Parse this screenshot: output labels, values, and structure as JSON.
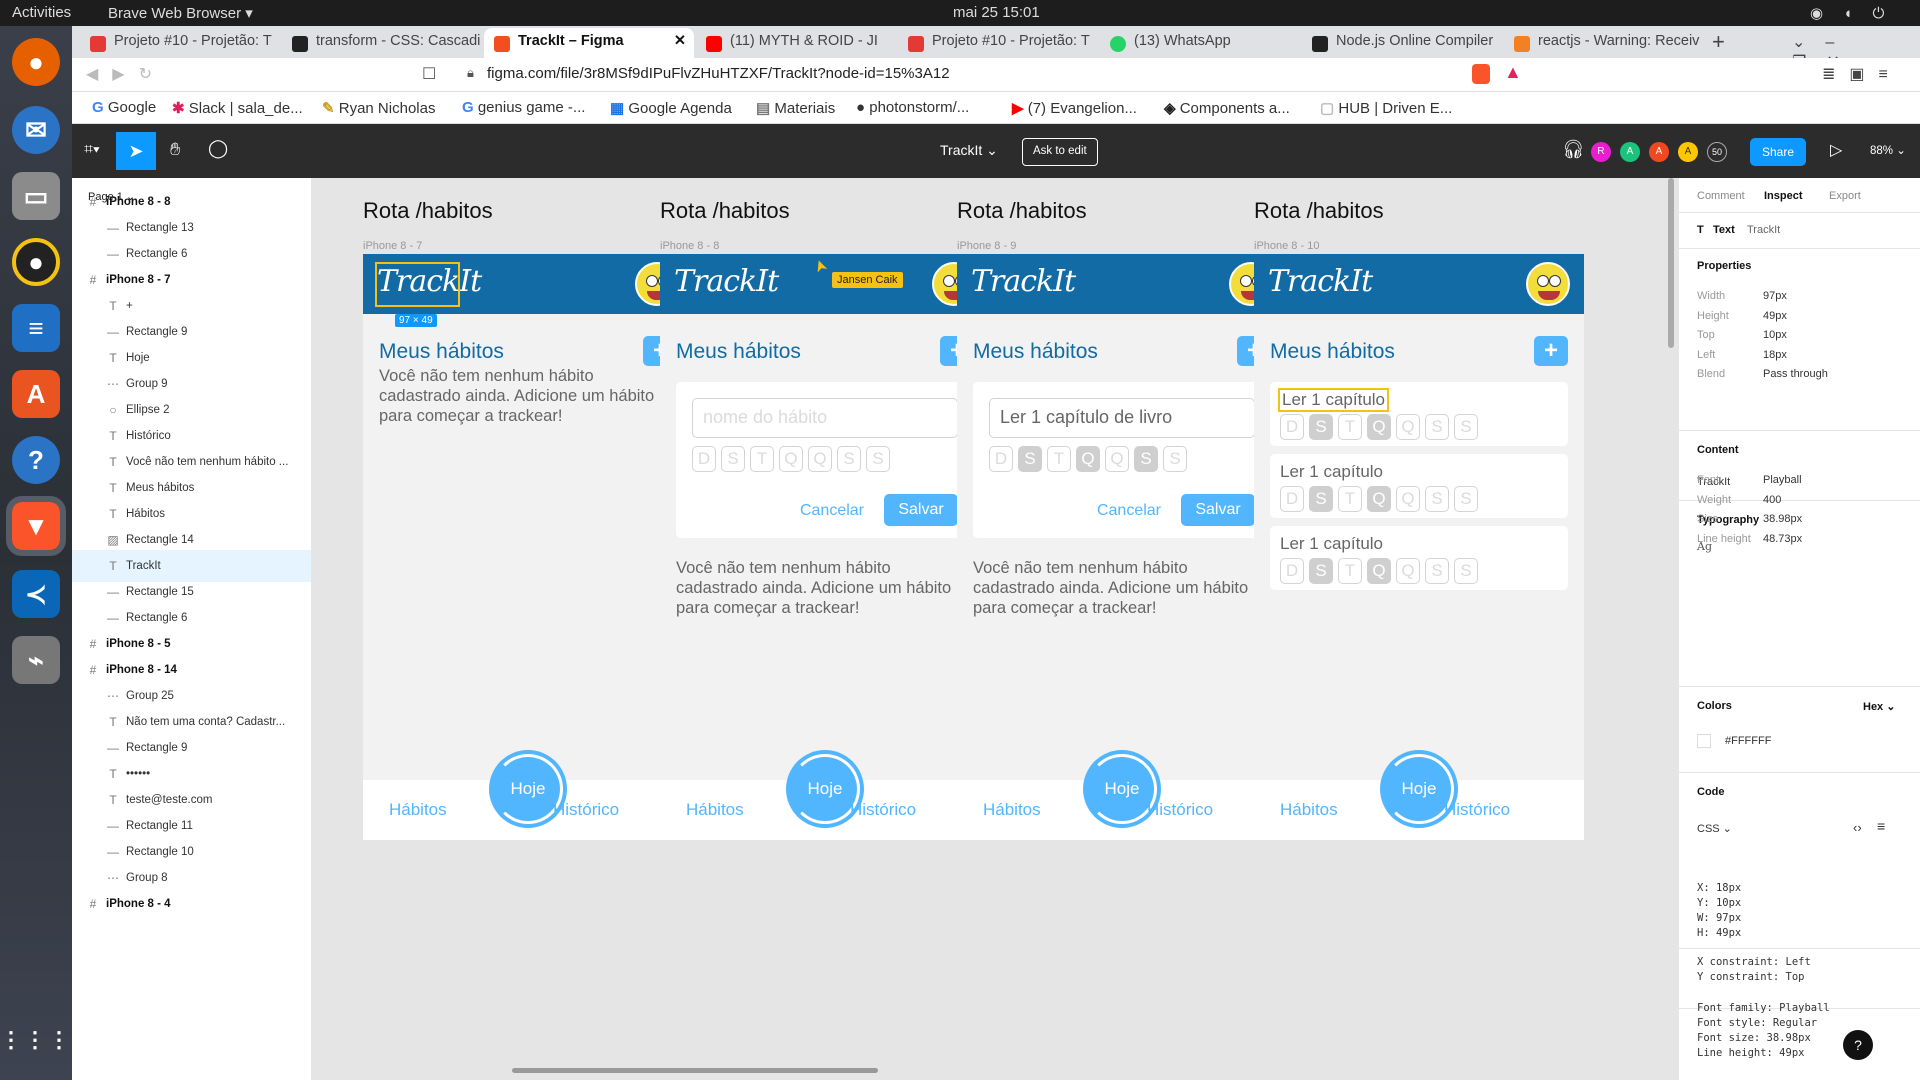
{
  "os": {
    "activities": "Activities",
    "browser": "Brave Web Browser",
    "clock": "mai 25  15:01"
  },
  "tabs": [
    {
      "label": "Projeto #10 - Projetão: T",
      "color": "#e53935"
    },
    {
      "label": "transform - CSS: Cascadi",
      "color": "#222222"
    },
    {
      "label": "TrackIt – Figma",
      "color": "#f24e1e",
      "active": true
    },
    {
      "label": "(11) MYTH & ROID - JI",
      "color": "#ff0000"
    },
    {
      "label": "Projeto #10 - Projetão: T",
      "color": "#e53935"
    },
    {
      "label": "(13) WhatsApp",
      "color": "#25d366"
    },
    {
      "label": "Node.js Online Compiler",
      "color": "#222222"
    },
    {
      "label": "reactjs - Warning: Receiv",
      "color": "#f48024"
    }
  ],
  "url": "figma.com/file/3r8MSf9dIPuFlvZHuHTZXF/TrackIt?node-id=15%3A12",
  "bookmarks": [
    "Google",
    "Slack | sala_de...",
    "Ryan Nicholas",
    "genius game -...",
    "Google Agenda",
    "Materiais",
    "photonstorm/...",
    "(7) Evangelion...",
    "Components a...",
    "HUB | Driven E..."
  ],
  "figma": {
    "file": "TrackIt",
    "ask": "Ask to edit",
    "share": "Share",
    "zoom": "88%",
    "count": "50",
    "avatars": [
      "R",
      "A",
      "A",
      "A"
    ]
  },
  "layers": {
    "page": "Page 1",
    "items": [
      {
        "t": "iPhone 8 - 8",
        "k": "frame"
      },
      {
        "t": "Rectangle 13",
        "k": "rect"
      },
      {
        "t": "Rectangle 6",
        "k": "rect"
      },
      {
        "t": "iPhone 8 - 7",
        "k": "frame"
      },
      {
        "t": "+",
        "k": "text"
      },
      {
        "t": "Rectangle 9",
        "k": "rect"
      },
      {
        "t": "Hoje",
        "k": "text"
      },
      {
        "t": "Group 9",
        "k": "group"
      },
      {
        "t": "Ellipse 2",
        "k": "ellipse"
      },
      {
        "t": "Histórico",
        "k": "text"
      },
      {
        "t": "Você não tem nenhum hábito ...",
        "k": "text"
      },
      {
        "t": "Meus hábitos",
        "k": "text"
      },
      {
        "t": "Hábitos",
        "k": "text"
      },
      {
        "t": "Rectangle 14",
        "k": "image"
      },
      {
        "t": "TrackIt",
        "k": "text",
        "sel": true
      },
      {
        "t": "Rectangle 15",
        "k": "rect"
      },
      {
        "t": "Rectangle 6",
        "k": "rect"
      },
      {
        "t": "iPhone 8 - 5",
        "k": "frame"
      },
      {
        "t": "iPhone 8 - 14",
        "k": "frame"
      },
      {
        "t": "Group 25",
        "k": "group"
      },
      {
        "t": "Não tem uma conta? Cadastr...",
        "k": "text"
      },
      {
        "t": "Rectangle 9",
        "k": "rect"
      },
      {
        "t": "••••••",
        "k": "text"
      },
      {
        "t": "teste@teste.com",
        "k": "text"
      },
      {
        "t": "Rectangle 11",
        "k": "rect"
      },
      {
        "t": "Rectangle 10",
        "k": "rect"
      },
      {
        "t": "Group 8",
        "k": "group"
      },
      {
        "t": "iPhone 8 - 4",
        "k": "frame"
      }
    ]
  },
  "canvas": {
    "route": "Rota /habitos",
    "frames": [
      "iPhone 8 - 7",
      "iPhone 8 - 8",
      "iPhone 8 - 9",
      "iPhone 8 - 10"
    ],
    "logo": "TrackIt",
    "title": "Meus hábitos",
    "plus": "+",
    "empty": "Você não tem nenhum hábito cadastrado ainda. Adicione um hábito para começar a trackear!",
    "placeholder": "nome do hábito",
    "filled": "Ler 1 capítulo de livro",
    "short": "Ler 1 capítulo",
    "days": [
      "D",
      "S",
      "T",
      "Q",
      "Q",
      "S",
      "S"
    ],
    "cancel": "Cancelar",
    "save": "Salvar",
    "nav": {
      "habits": "Hábitos",
      "today": "Hoje",
      "history": "Histórico"
    },
    "sizebadge": "97 × 49",
    "cursor_user": "Jansen Caik"
  },
  "inspect": {
    "tabs": [
      "Comment",
      "Inspect",
      "Export"
    ],
    "layer_type": "Text",
    "layer_name": "TrackIt",
    "properties_title": "Properties",
    "props": [
      [
        "Width",
        "97px"
      ],
      [
        "Height",
        "49px"
      ],
      [
        "Top",
        "10px"
      ],
      [
        "Left",
        "18px"
      ],
      [
        "Blend",
        "Pass through"
      ]
    ],
    "content_title": "Content",
    "content": "TrackIt",
    "typo_title": "Typography",
    "ag": "Ag",
    "typo": [
      [
        "Font",
        "Playball"
      ],
      [
        "Weight",
        "400"
      ],
      [
        "Size",
        "38.98px"
      ],
      [
        "Line height",
        "48.73px"
      ]
    ],
    "colors_title": "Colors",
    "color_mode": "Hex",
    "color": "#FFFFFF",
    "code_title": "Code",
    "code_lang": "CSS",
    "code1": [
      "X: 18px",
      "Y: 10px",
      "W: 97px",
      "H: 49px"
    ],
    "code2": [
      "X constraint: Left",
      "Y constraint: Top"
    ],
    "code3": [
      "Font family: Playball",
      "Font style: Regular",
      "Font size: 38.98px",
      "Line height: 49px"
    ]
  }
}
